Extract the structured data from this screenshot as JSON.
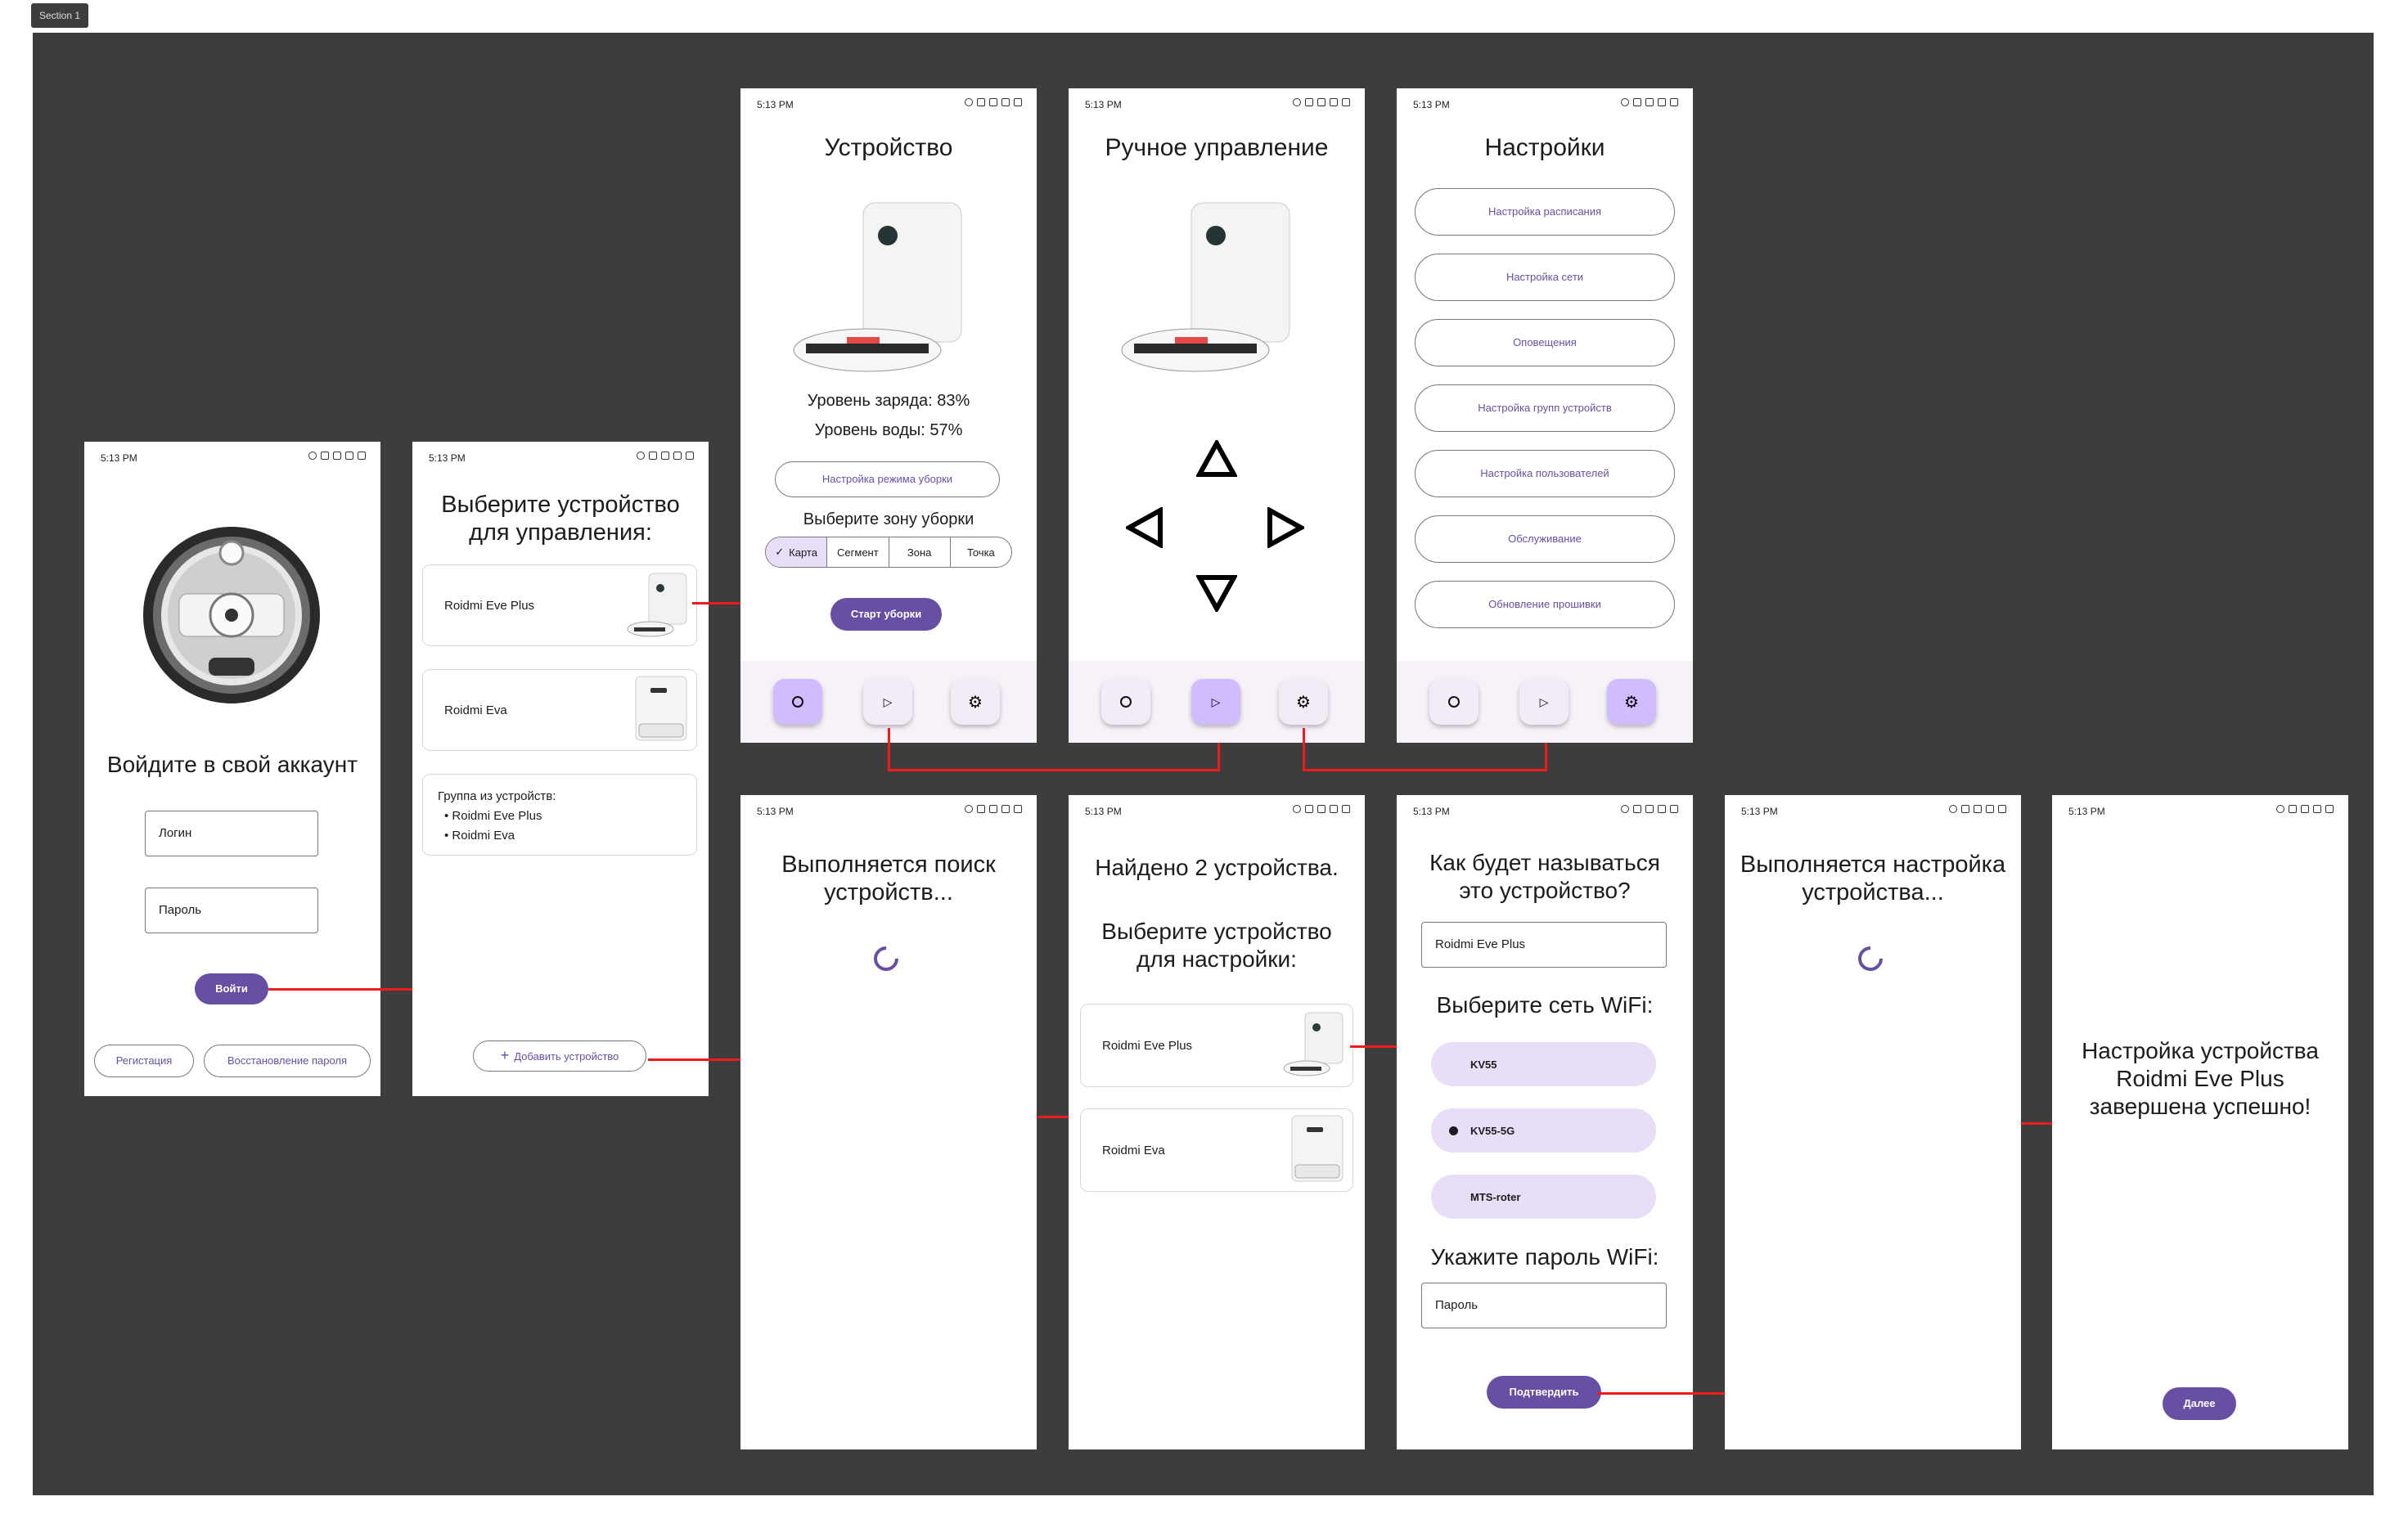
{
  "section_label": "Section 1",
  "status_time": "5:13 PM",
  "login": {
    "title": "Войдите в свой аккаунт",
    "login_placeholder": "Логин",
    "password_placeholder": "Пароль",
    "submit": "Войти",
    "register": "Регистация",
    "restore": "Восстановление пароля"
  },
  "select_device": {
    "title": "Выберите устройство для управления:",
    "devices": [
      "Roidmi Eve Plus",
      "Roidmi Eva"
    ],
    "group_title": "Группа из устройств:",
    "group_items": [
      "Roidmi Eve Plus",
      "Roidmi Eva"
    ],
    "add_device": "Добавить устройство"
  },
  "device": {
    "title": "Устройство",
    "charge": "Уровень заряда: 83%",
    "water": "Уровень воды: 57%",
    "mode_button": "Настройка режима уборки",
    "zone_title": "Выберите зону уборки",
    "zones": [
      "Карта",
      "Сегмент",
      "Зона",
      "Точка"
    ],
    "start": "Старт уборки"
  },
  "manual": {
    "title": "Ручное управление"
  },
  "settings": {
    "title": "Настройки",
    "items": [
      "Настройка расписания",
      "Настройка сети",
      "Оповещения",
      "Настройка групп устройств",
      "Настройка пользователей",
      "Обслуживание",
      "Обновление прошивки"
    ]
  },
  "searching": {
    "title": "Выполняется поиск устройств..."
  },
  "found": {
    "title": "Найдено 2 устройства.",
    "subtitle": "Выберите устройство для настройки:",
    "devices": [
      "Roidmi Eve Plus",
      "Roidmi Eva"
    ]
  },
  "naming": {
    "title": "Как будет называться это устройство?",
    "name_value": "Roidmi Eve Plus",
    "wifi_title": "Выберите сеть WiFi:",
    "networks": [
      "KV55",
      "KV55-5G",
      "MTS-roter"
    ],
    "selected_network": "KV55-5G",
    "password_title": "Укажите пароль WiFi:",
    "password_placeholder": "Пароль",
    "confirm": "Подтвердить"
  },
  "configuring": {
    "title": "Выполняется настройка устройства..."
  },
  "done": {
    "title": "Настройка устройства Roidmi Eve Plus завершена успешно!",
    "next": "Далее"
  },
  "colors": {
    "primary": "#6750a4",
    "canvas": "#3d3d3d",
    "nav_active": "#d0bcff",
    "chip": "#e8def8",
    "connector": "#ee1b1b"
  }
}
